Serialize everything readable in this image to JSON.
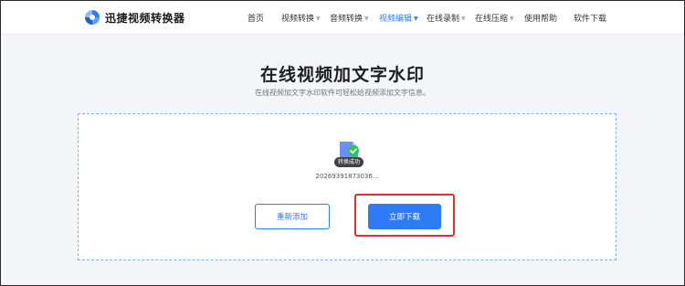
{
  "app": {
    "brand": "迅捷视频转换器",
    "logo_icon": "swirl-logo-icon",
    "accent_color": "#2e7bf6"
  },
  "nav": {
    "items": [
      {
        "label": "首页",
        "has_dropdown": false,
        "active": false
      },
      {
        "label": "视频转换",
        "has_dropdown": true,
        "active": false
      },
      {
        "label": "音频转换",
        "has_dropdown": true,
        "active": false
      },
      {
        "label": "视频编辑",
        "has_dropdown": true,
        "active": true
      },
      {
        "label": "在线录制",
        "has_dropdown": true,
        "active": false
      },
      {
        "label": "在线压缩",
        "has_dropdown": true,
        "active": false
      },
      {
        "label": "使用帮助",
        "has_dropdown": false,
        "active": false
      },
      {
        "label": "软件下载",
        "has_dropdown": false,
        "active": false
      }
    ]
  },
  "page": {
    "title": "在线视频加文字水印",
    "subtitle": "在线视频加文字水印软件可轻松给视频添加文字信息。"
  },
  "upload": {
    "file_icon": "video-file-icon",
    "status_badge": "转换成功",
    "filename": "20269391873036...",
    "readd_label": "重新添加",
    "download_label": "立即下载",
    "highlight_color": "#d9342b"
  }
}
